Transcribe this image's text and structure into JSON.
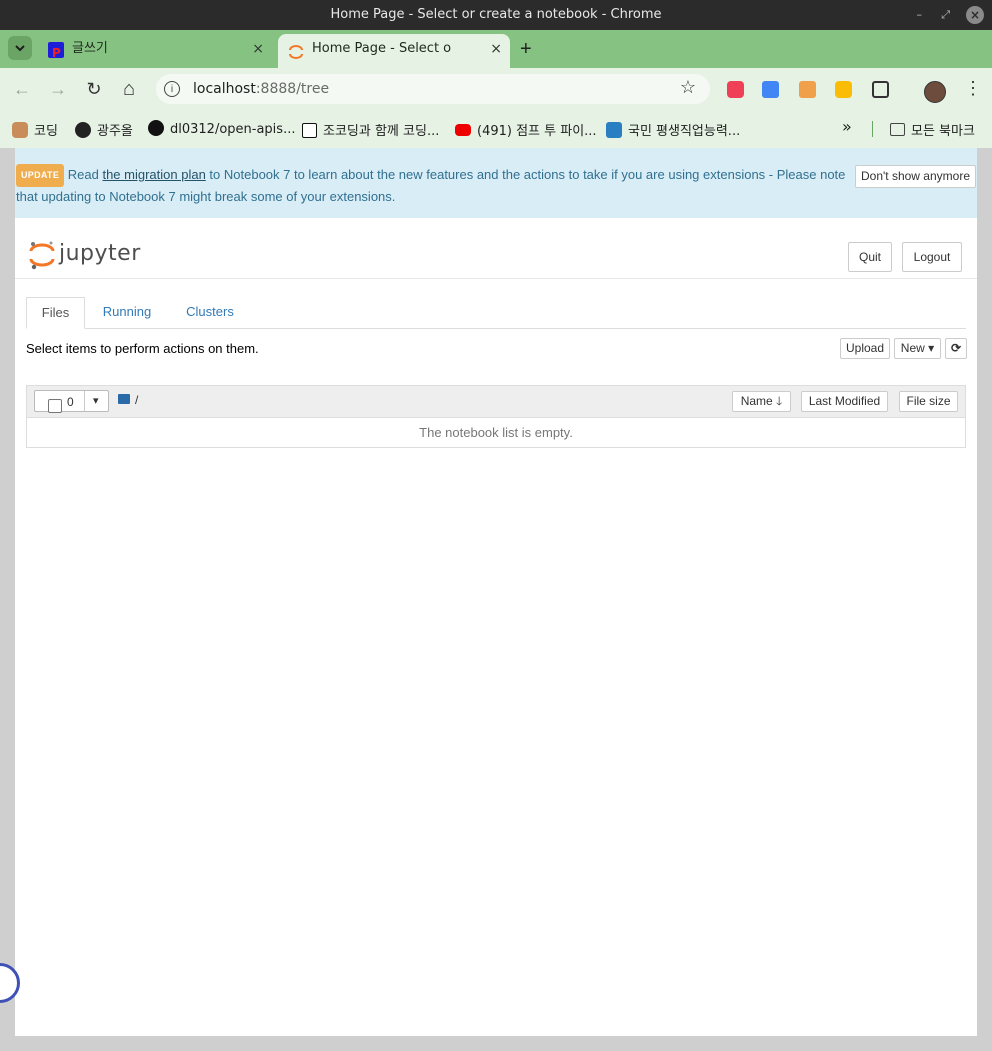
{
  "window": {
    "title": "Home Page - Select or create a notebook - Chrome",
    "controls": [
      "–",
      "⤢",
      "×"
    ]
  },
  "tabs": [
    {
      "label": "글쓰기",
      "close": "×",
      "active": false
    },
    {
      "label": "Home Page - Select or create a notebook",
      "close": "×",
      "active": true
    }
  ],
  "new_tab": "+",
  "toolbar": {
    "back": "←",
    "forward": "→",
    "reload": "↻",
    "home": "⌂",
    "url_host": "localhost",
    "url_rest": ":8888/tree",
    "info_icon": "i",
    "star": "☆",
    "menu": "⋮"
  },
  "bookmarks": {
    "items": [
      {
        "label": "코딩"
      },
      {
        "label": "광주올"
      },
      {
        "label": "dl0312/open-apis..."
      },
      {
        "label": "조코딩과 함께 코딩..."
      },
      {
        "label": "(491) 점프 투 파이..."
      },
      {
        "label": "국민 평생직업능력..."
      }
    ],
    "more": "»",
    "all_bookmarks": "모든 북마크"
  },
  "banner": {
    "badge": "UPDATE",
    "text_before": "Read ",
    "link": "the migration plan",
    "text_after": " to Notebook 7 to learn about the new features and the actions to take if you are using extensions - Please note that updating to Notebook 7 might break some of your extensions.",
    "dismiss_button": "Don't show anymore"
  },
  "header": {
    "logo": "jupyter",
    "quit": "Quit",
    "logout": "Logout"
  },
  "nav_tabs": [
    "Files",
    "Running",
    "Clusters"
  ],
  "actions": {
    "hint": "Select items to perform actions on them.",
    "upload": "Upload",
    "new": "New",
    "new_caret": "▾",
    "refresh": "⟳"
  },
  "file_list": {
    "selected_count": "0",
    "dropdown_caret": "▾",
    "path": "/",
    "columns": {
      "name": "Name",
      "name_sort": "🡓",
      "last_modified": "Last Modified",
      "file_size": "File size"
    },
    "empty_message": "The notebook list is empty."
  },
  "colors": {
    "tab_strip": "#86c383",
    "toolbar": "#e6f2e4",
    "banner_bg": "#d9edf7",
    "banner_text": "#31708f",
    "badge": "#f0ad4e",
    "link": "#337ab7",
    "jupyter_orange": "#f37726"
  }
}
